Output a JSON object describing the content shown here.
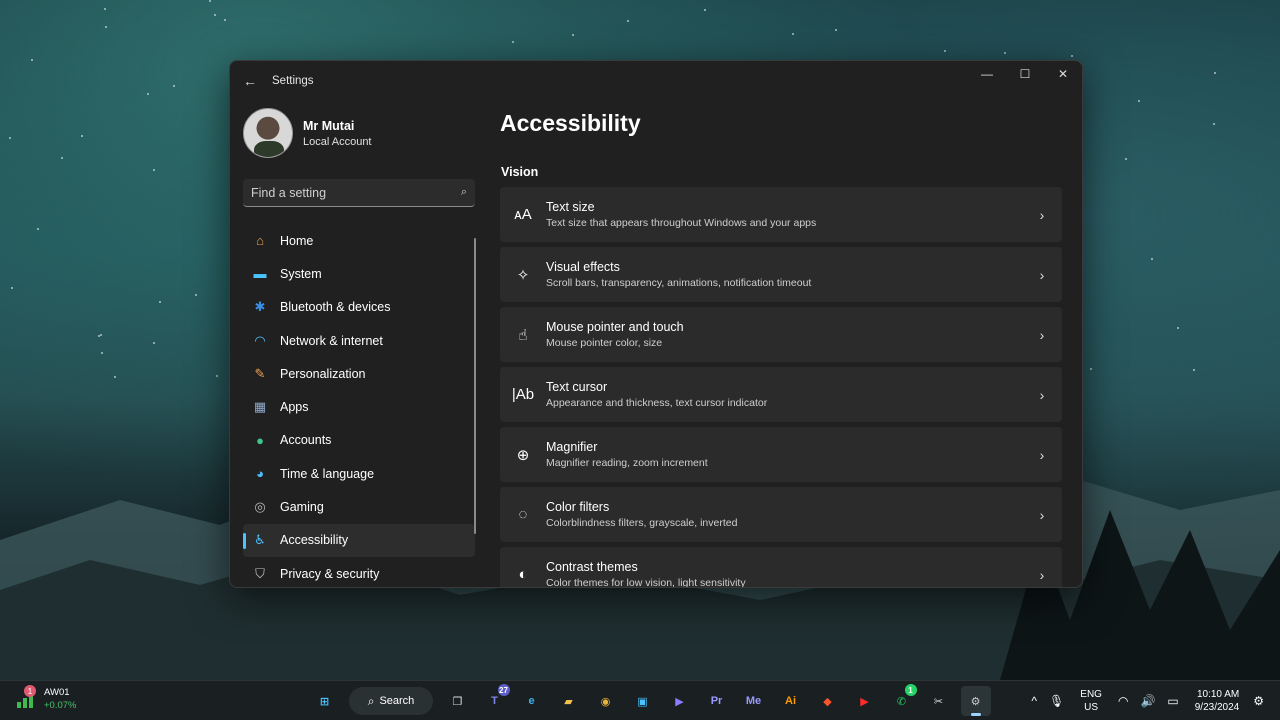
{
  "window": {
    "app_title": "Settings",
    "back": "←",
    "minimize": "—",
    "maximize": "☐",
    "close": "✕"
  },
  "profile": {
    "name": "Mr Mutai",
    "account_type": "Local Account"
  },
  "search": {
    "placeholder": "Find a setting",
    "icon": "search-icon"
  },
  "nav": {
    "items": [
      {
        "label": "Home",
        "icon": "home-icon",
        "glyph": "⌂",
        "color": "#f0a050"
      },
      {
        "label": "System",
        "icon": "system-icon",
        "glyph": "▬",
        "color": "#4cc2ff"
      },
      {
        "label": "Bluetooth & devices",
        "icon": "bluetooth-icon",
        "glyph": "✱",
        "color": "#3a8ee6"
      },
      {
        "label": "Network & internet",
        "icon": "wifi-icon",
        "glyph": "◠",
        "color": "#4cc2ff"
      },
      {
        "label": "Personalization",
        "icon": "brush-icon",
        "glyph": "✎",
        "color": "#f2a35a"
      },
      {
        "label": "Apps",
        "icon": "apps-icon",
        "glyph": "▦",
        "color": "#8fa8c8"
      },
      {
        "label": "Accounts",
        "icon": "accounts-icon",
        "glyph": "●",
        "color": "#3bc48c"
      },
      {
        "label": "Time & language",
        "icon": "globe-icon",
        "glyph": "◕",
        "color": "#4cc2ff"
      },
      {
        "label": "Gaming",
        "icon": "gamepad-icon",
        "glyph": "◎",
        "color": "#b8b8b8"
      },
      {
        "label": "Accessibility",
        "icon": "accessibility-icon",
        "glyph": "♿",
        "color": "#4cc2ff"
      },
      {
        "label": "Privacy & security",
        "icon": "shield-icon",
        "glyph": "⛉",
        "color": "#c8c8c8"
      }
    ],
    "active_index": 9
  },
  "main": {
    "title": "Accessibility",
    "section": "Vision",
    "cards": [
      {
        "title": "Text size",
        "subtitle": "Text size that appears throughout Windows and your apps",
        "icon": "text-size-icon",
        "glyph": "ᴀA"
      },
      {
        "title": "Visual effects",
        "subtitle": "Scroll bars, transparency, animations, notification timeout",
        "icon": "visual-effects-icon",
        "glyph": "✧"
      },
      {
        "title": "Mouse pointer and touch",
        "subtitle": "Mouse pointer color, size",
        "icon": "mouse-pointer-icon",
        "glyph": "☝"
      },
      {
        "title": "Text cursor",
        "subtitle": "Appearance and thickness, text cursor indicator",
        "icon": "text-cursor-icon",
        "glyph": "|Ab"
      },
      {
        "title": "Magnifier",
        "subtitle": "Magnifier reading, zoom increment",
        "icon": "magnifier-icon",
        "glyph": "⊕"
      },
      {
        "title": "Color filters",
        "subtitle": "Colorblindness filters, grayscale, inverted",
        "icon": "color-filters-icon",
        "glyph": "◌"
      },
      {
        "title": "Contrast themes",
        "subtitle": "Color themes for low vision, light sensitivity",
        "icon": "contrast-icon",
        "glyph": "◐"
      }
    ],
    "chevron": "›"
  },
  "taskbar": {
    "widget": {
      "badge": "1",
      "name": "AW01",
      "change": "+0.07%"
    },
    "search_label": "Search",
    "apps": [
      {
        "name": "start-icon",
        "glyph": "⊞",
        "color": "#4cc2ff"
      },
      {
        "name": "task-view-icon",
        "glyph": "❐",
        "color": "#dddddd"
      },
      {
        "name": "teams-icon",
        "glyph": "T",
        "color": "#7b83eb",
        "badge": "27"
      },
      {
        "name": "edge-icon",
        "glyph": "e",
        "color": "#3ab0e8"
      },
      {
        "name": "file-explorer-icon",
        "glyph": "▰",
        "color": "#f2c14e"
      },
      {
        "name": "chrome-icon",
        "glyph": "◉",
        "color": "#e8b23a"
      },
      {
        "name": "store-icon",
        "glyph": "▣",
        "color": "#4cc2ff"
      },
      {
        "name": "clipchamp-icon",
        "glyph": "▶",
        "color": "#8f7bff"
      },
      {
        "name": "premiere-icon",
        "glyph": "Pr",
        "color": "#9999ff"
      },
      {
        "name": "media-encoder-icon",
        "glyph": "Me",
        "color": "#9999ff"
      },
      {
        "name": "illustrator-icon",
        "glyph": "Ai",
        "color": "#ff9a00"
      },
      {
        "name": "brave-icon",
        "glyph": "◆",
        "color": "#fb542b"
      },
      {
        "name": "youtube-icon",
        "glyph": "▶",
        "color": "#ff2a2a"
      },
      {
        "name": "whatsapp-icon",
        "glyph": "✆",
        "color": "#25d366",
        "badge": "1"
      },
      {
        "name": "snipping-tool-icon",
        "glyph": "✂",
        "color": "#dddddd"
      },
      {
        "name": "settings-icon",
        "glyph": "⚙",
        "color": "#cccccc",
        "active": true
      }
    ],
    "tray": {
      "chevron": "^",
      "lang_top": "ENG",
      "lang_bottom": "US",
      "time": "10:10 AM",
      "date": "9/23/2024"
    }
  }
}
